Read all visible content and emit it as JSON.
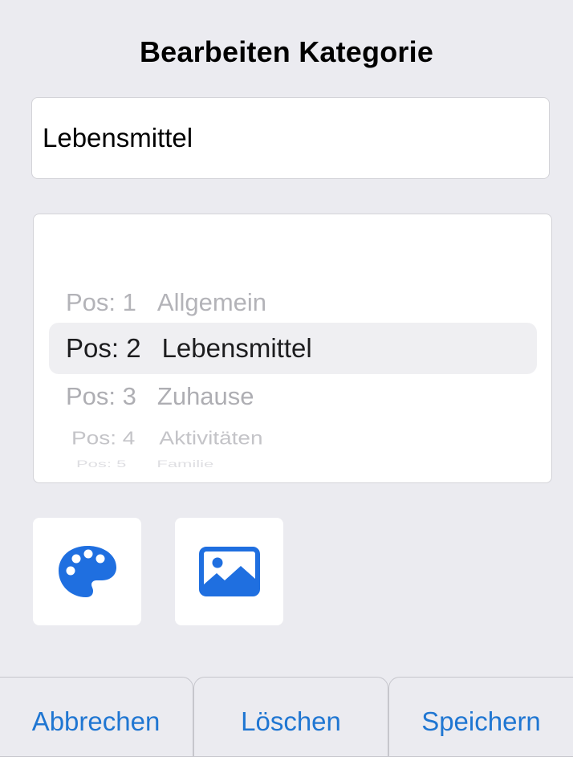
{
  "dialog": {
    "title": "Bearbeiten Kategorie"
  },
  "name_field": {
    "value": "Lebensmittel"
  },
  "position_picker": {
    "rows": [
      {
        "pos": "Pos: 1",
        "label": "Allgemein"
      },
      {
        "pos": "Pos: 2",
        "label": "Lebensmittel"
      },
      {
        "pos": "Pos: 3",
        "label": "Zuhause"
      },
      {
        "pos": "Pos: 4",
        "label": "Aktivitäten"
      },
      {
        "pos": "Pos: 5",
        "label": "Familie"
      }
    ],
    "selected_index": 1
  },
  "icons": {
    "palette": "palette-icon",
    "image": "image-icon",
    "accent_color": "#1f6fe0"
  },
  "toolbar": {
    "cancel_label": "Abbrechen",
    "delete_label": "Löschen",
    "save_label": "Speichern",
    "link_color": "#1f76d2"
  }
}
